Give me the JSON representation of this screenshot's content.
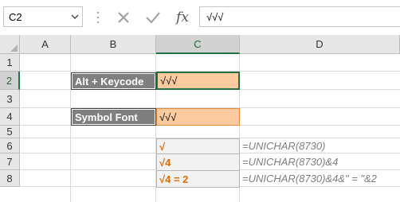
{
  "formula_bar": {
    "name_box": "C2",
    "fx_label": "fx",
    "formula_value": "√√√"
  },
  "columns": [
    "A",
    "B",
    "C",
    "D"
  ],
  "rows": [
    "1",
    "2",
    "3",
    "4",
    "5",
    "6",
    "7",
    "8"
  ],
  "selected": {
    "column": "C",
    "row": "2"
  },
  "cells": {
    "b2": "Alt + Keycode",
    "c2": "√√√",
    "b4": "Symbol Font",
    "c4": "√√√",
    "c6": "√",
    "d6": "=UNICHAR(8730)",
    "c7": "√4",
    "d7": "=UNICHAR(8730)&4",
    "c8": "√4 = 2",
    "d8": "=UNICHAR(8730)&4&\" = \"&2"
  },
  "icons": {
    "dropdown": "chevron-down-icon",
    "cancel": "cancel-x-icon",
    "enter": "checkmark-icon",
    "function": "insert-function-icon",
    "select_all": "select-all-triangle-icon"
  },
  "colors": {
    "label_fill": "#7f7f7f",
    "orange_fill": "#fbcb9f",
    "result_text": "#e26b0a",
    "selection": "#217346"
  }
}
